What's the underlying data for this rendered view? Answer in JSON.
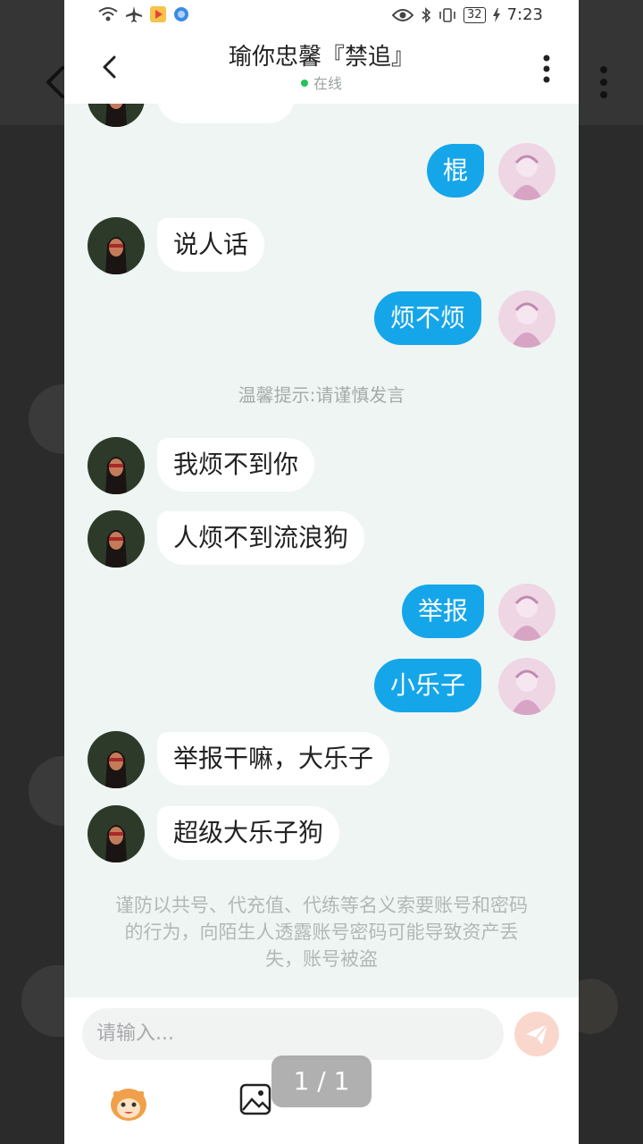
{
  "status_bar": {
    "time": "7:23",
    "battery": "32"
  },
  "header": {
    "title": "瑜你忠馨『禁追』",
    "status": "在线"
  },
  "messages": [
    {
      "side": "right",
      "text": "棍"
    },
    {
      "side": "left",
      "text": "说人话"
    },
    {
      "side": "right",
      "text": "烦不烦"
    },
    {
      "side": "left",
      "text": "我烦不到你"
    },
    {
      "side": "left",
      "text": "人烦不到流浪狗"
    },
    {
      "side": "right",
      "text": "举报"
    },
    {
      "side": "right",
      "text": "小乐子"
    },
    {
      "side": "left",
      "text": "举报干嘛，大乐子"
    },
    {
      "side": "left",
      "text": "超级大乐子狗"
    }
  ],
  "system_tip": "温馨提示:请谨慎发言",
  "warning": "谨防以共号、代充值、代练等名义索要账号和密码的行为，向陌生人透露账号密码可能导致资产丢失，账号被盗",
  "input": {
    "placeholder": "请输入..."
  },
  "page_indicator": "1 / 1",
  "colors": {
    "sent_bubble": "#15a6ea",
    "chat_background": "#eff5f3",
    "online_dot": "#21c45a"
  }
}
